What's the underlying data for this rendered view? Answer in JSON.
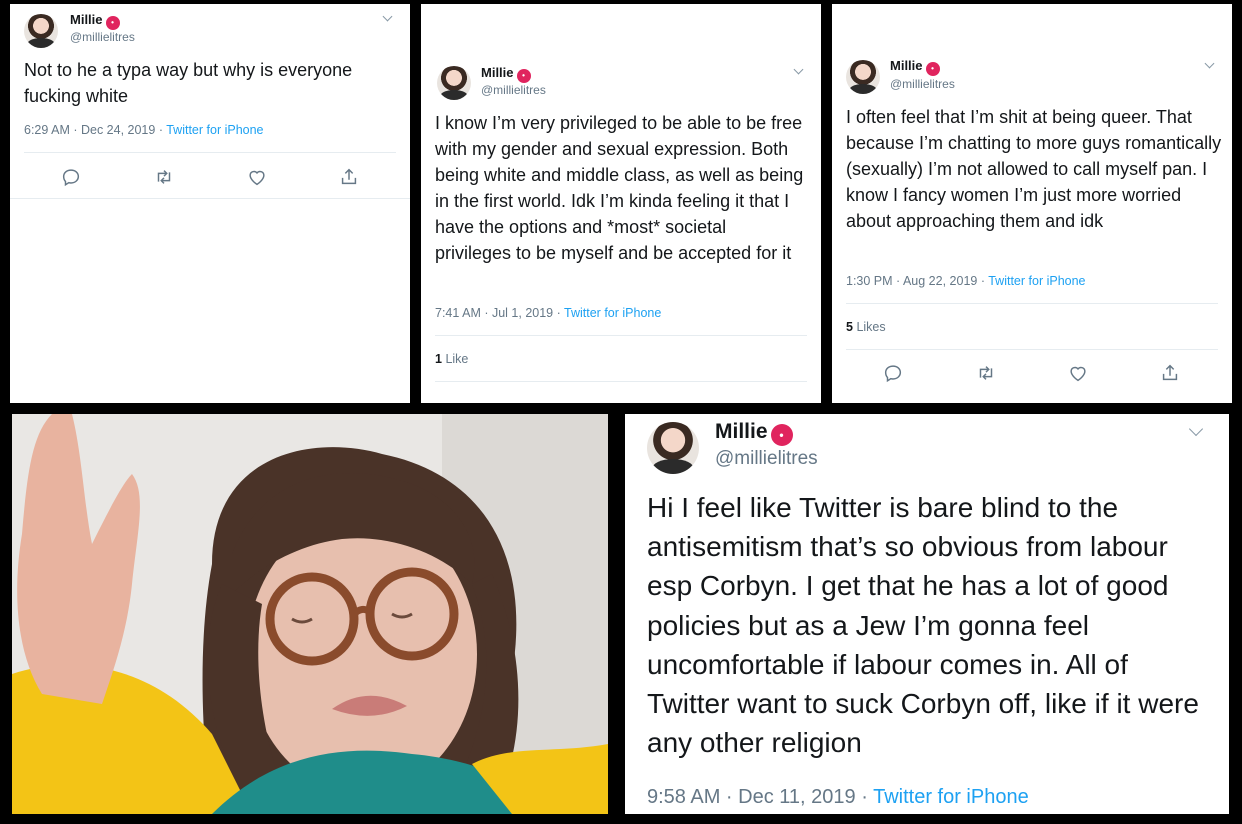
{
  "user": {
    "name": "Millie",
    "handle": "@millielitres",
    "emoji": "🥵"
  },
  "tweets": [
    {
      "text": "Not to he a typa way but why is everyone fucking white",
      "time": "6:29 AM · Dec 24, 2019",
      "source": "Twitter for iPhone"
    },
    {
      "text": "I know I’m very privileged to be able to be free with my gender and sexual expression. Both being white and middle class, as well as being in the first world. Idk I’m kinda feeling it that I have the options and *most* societal privileges to be myself and be accepted for it",
      "time": "7:41 AM · Jul 1, 2019",
      "source": "Twitter for iPhone",
      "likes_count": "1",
      "likes_label": "Like"
    },
    {
      "text": "I often feel that I’m shit at being queer. That because I’m chatting to more guys romantically (sexually) I’m not allowed to call myself pan. I know I fancy women I’m just more worried about approaching them and idk",
      "time": "1:30 PM · Aug 22, 2019",
      "source": "Twitter for iPhone",
      "likes_count": "5",
      "likes_label": "Likes"
    },
    {
      "text": "Hi I feel like Twitter is bare blind to the antisemitism that’s so obvious from labour esp Corbyn. I get that he has a lot of good policies but as a Jew I’m gonna feel uncomfortable if labour comes in. All of Twitter want to suck Corbyn off, like if it were any other religion",
      "time": "9:58 AM · Dec 11, 2019",
      "source": "Twitter for iPhone"
    }
  ],
  "separator": " · ",
  "colors": {
    "link": "#1da1f2",
    "muted": "#657786",
    "text": "#14171a",
    "border": "#e6ecf0"
  }
}
